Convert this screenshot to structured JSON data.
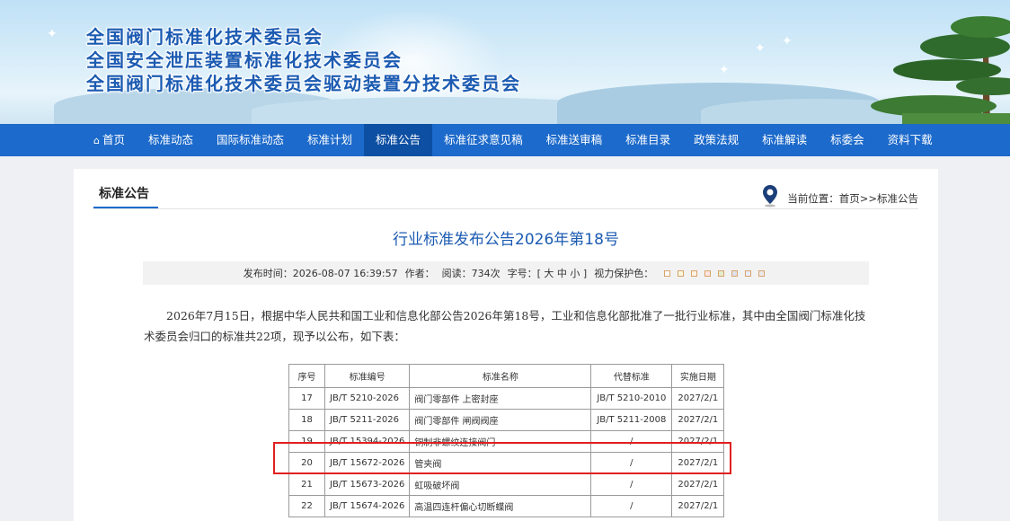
{
  "header": {
    "titles": [
      "全国阀门标准化技术委员会",
      "全国安全泄压装置标准化技术委员会",
      "全国阀门标准化技术委员会驱动装置分技术委员会"
    ]
  },
  "nav": {
    "items": [
      {
        "label": "首页",
        "icon": "home-icon"
      },
      {
        "label": "标准动态"
      },
      {
        "label": "国际标准动态"
      },
      {
        "label": "标准计划"
      },
      {
        "label": "标准公告",
        "active": true
      },
      {
        "label": "标准征求意见稿"
      },
      {
        "label": "标准送审稿"
      },
      {
        "label": "标准目录"
      },
      {
        "label": "政策法规"
      },
      {
        "label": "标准解读"
      },
      {
        "label": "标委会"
      },
      {
        "label": "资料下载"
      }
    ]
  },
  "section": {
    "title": "标准公告",
    "location_label": "当前位置：首页>>标准公告"
  },
  "article": {
    "title": "行业标准发布公告2026年第18号",
    "meta": {
      "published": "发布时间：2026-08-07 16:39:57",
      "author": "作者：",
      "reads": "阅读：734次",
      "font_size": "字号：[ 大 中 小 ]",
      "eye_care": "视力保护色：",
      "swatch_colors": [
        "#ffffff",
        "#faf9de",
        "#fff2e2",
        "#fde6e0",
        "#e3edcd",
        "#dce2f1",
        "#e9ebfe",
        "#eaeaef"
      ]
    },
    "intro": "2026年7月15日，根据中华人民共和国工业和信息化部公告2026年第18号，工业和信息化部批准了一批行业标准，其中由全国阀门标准化技术委员会归口的标准共22项，现予以公布，如下表："
  },
  "table": {
    "headers": [
      "序号",
      "标准编号",
      "标准名称",
      "代替标准",
      "实施日期"
    ],
    "rows": [
      [
        "17",
        "JB/T 5210-2026",
        "阀门零部件 上密封座",
        "JB/T 5210-2010",
        "2027/2/1"
      ],
      [
        "18",
        "JB/T 5211-2026",
        "阀门零部件 闸阀阀座",
        "JB/T 5211-2008",
        "2027/2/1"
      ],
      [
        "19",
        "JB/T 15394-2026",
        "铜制非螺纹连接阀门",
        "/",
        "2027/2/1"
      ],
      [
        "20",
        "JB/T 15672-2026",
        "管夹阀",
        "/",
        "2027/2/1"
      ],
      [
        "21",
        "JB/T 15673-2026",
        "虹吸破坏阀",
        "/",
        "2027/2/1"
      ],
      [
        "22",
        "JB/T 15674-2026",
        "高温四连杆偏心切断蝶阀",
        "/",
        "2027/2/1"
      ]
    ],
    "highlighted_row": "20"
  },
  "colors": {
    "nav_bg": "#1c6acb",
    "nav_active": "#0d4fa2",
    "title_blue": "#1c5bb2",
    "highlight_red": "#e02020"
  }
}
